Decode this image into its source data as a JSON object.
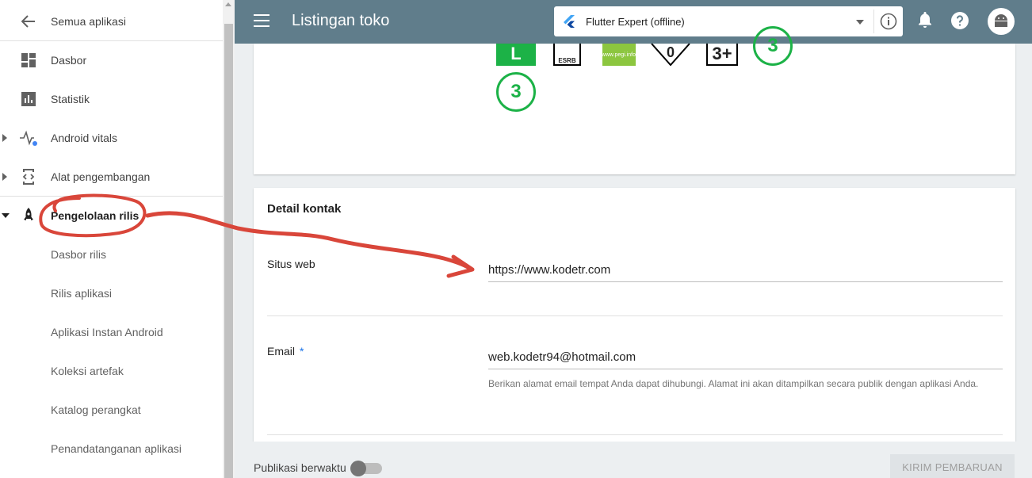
{
  "sidebar": {
    "back_label": "Semua aplikasi",
    "items": [
      {
        "label": "Dasbor"
      },
      {
        "label": "Statistik"
      },
      {
        "label": "Android vitals"
      },
      {
        "label": "Alat pengembangan"
      },
      {
        "label": "Pengelolaan rilis"
      }
    ],
    "sub_items": [
      {
        "label": "Dasbor rilis"
      },
      {
        "label": "Rilis aplikasi"
      },
      {
        "label": "Aplikasi Instan Android"
      },
      {
        "label": "Koleksi artefak"
      },
      {
        "label": "Katalog perangkat"
      },
      {
        "label": "Penandatanganan aplikasi"
      }
    ]
  },
  "header": {
    "title": "Listingan toko",
    "app_name": "Flutter Expert (offline)"
  },
  "ratings": {
    "l": "L",
    "esrb": "ESRB",
    "pegi": "www.pegi.info",
    "usk": "0",
    "plus": "3+",
    "circle1": "3",
    "circle2": "3"
  },
  "contact": {
    "title": "Detail kontak",
    "website_label": "Situs web",
    "website_value": "https://www.kodetr.com",
    "email_label": "Email",
    "email_required": "*",
    "email_value": "web.kodetr94@hotmail.com",
    "email_hint": "Berikan alamat email tempat Anda dapat dihubungi. Alamat ini akan ditampilkan secara publik dengan aplikasi Anda."
  },
  "footer": {
    "timed_publish_label": "Publikasi berwaktu",
    "send_button": "KIRIM PEMBARUAN"
  },
  "colors": {
    "topbar": "#607d8b",
    "rating_green": "#1cb247",
    "annotation_red": "#d9463a"
  }
}
